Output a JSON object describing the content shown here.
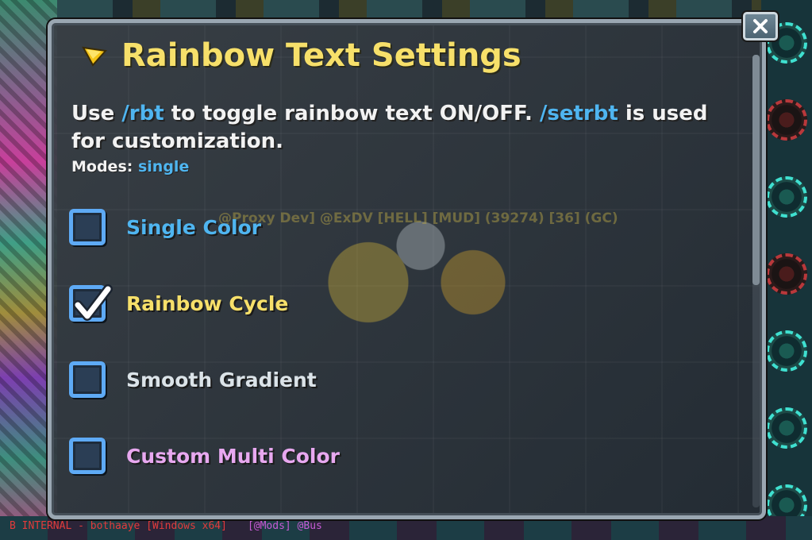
{
  "world": {
    "player_name_ghost": "@Proxy Dev] @ExDV [HELL] [MUD] (39274) [36] (GC)",
    "status_line": "B INTERNAL - bothaaye [Windows x64]",
    "mods_tag": "[@Mods] @Bus"
  },
  "dialog": {
    "title": "Rainbow Text Settings",
    "title_icon": "yellow-arrow-gem-icon",
    "desc_part1": "Use ",
    "desc_cmd1": "/rbt",
    "desc_part2": " to toggle rainbow text ON/OFF. ",
    "desc_cmd2": "/setrbt",
    "desc_part3": " is used for customization.",
    "modes_label": "Modes: ",
    "modes_value": "single",
    "options": [
      {
        "label": "Single Color",
        "checked": false,
        "color": "#4fb5f0"
      },
      {
        "label": "Rainbow Cycle",
        "checked": true,
        "color": "#f7e06a"
      },
      {
        "label": "Smooth Gradient",
        "checked": false,
        "color": "#dbe3e8"
      },
      {
        "label": "Custom Multi Color",
        "checked": false,
        "color": "#e8a8f0"
      }
    ],
    "close_icon": "close-x-icon"
  }
}
